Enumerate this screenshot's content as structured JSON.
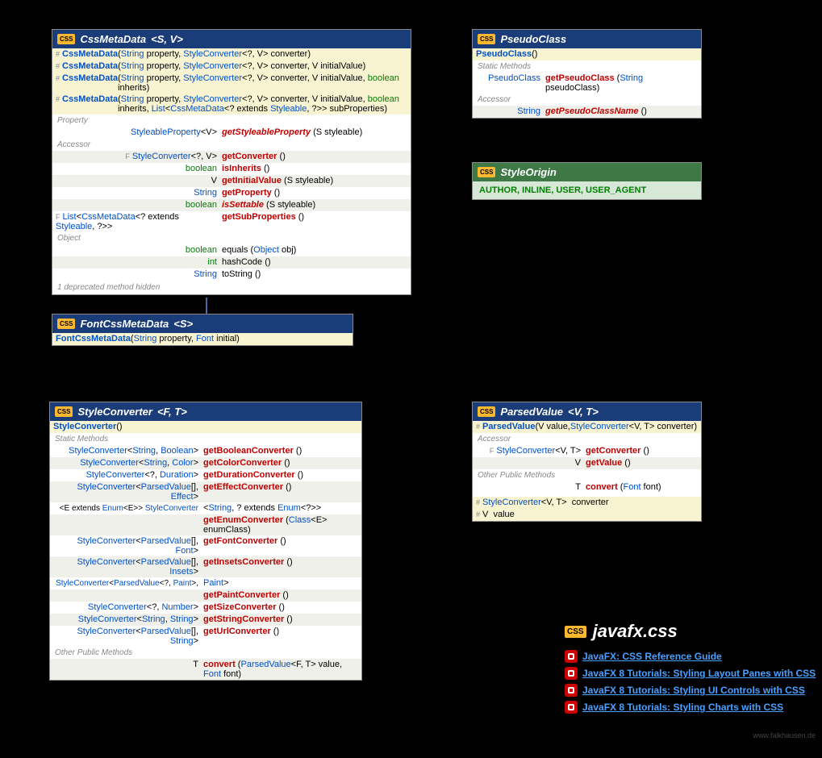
{
  "cards": {
    "cssMeta": {
      "title": "CssMetaData",
      "gp": "<S, V>",
      "ctrs": [
        {
          "name": "CssMetaData",
          "sig": "(String property, StyleConverter<?, V> converter)"
        },
        {
          "name": "CssMetaData",
          "sig": "(String property, StyleConverter<?, V> converter, V initialValue)"
        },
        {
          "name": "CssMetaData",
          "sig": "(String property, StyleConverter<?, V> converter, V initialValue, boolean inherits)"
        },
        {
          "name": "CssMetaData",
          "sig": "(String property, StyleConverter<?, V> converter, V initialValue, boolean inherits, List<CssMetaData<? extends Styleable, ?>> subProperties)"
        }
      ],
      "secProp": "Property",
      "prop": {
        "ret": "StyleableProperty<V>",
        "name": "getStyleableProperty",
        "sig": "(S styleable)"
      },
      "secAcc": "Accessor",
      "acc": [
        {
          "mod": "F",
          "ret": "StyleConverter<?, V>",
          "name": "getConverter",
          "sig": "()"
        },
        {
          "mod": "",
          "ret": "boolean",
          "name": "isInherits",
          "sig": "()",
          "kw": true
        },
        {
          "mod": "",
          "ret": "V",
          "name": "getInitialValue",
          "sig": "(S styleable)"
        },
        {
          "mod": "",
          "ret": "String",
          "name": "getProperty",
          "sig": "()"
        },
        {
          "mod": "",
          "ret": "boolean",
          "name": "isSettable",
          "sig": "(S styleable)",
          "kw": true
        },
        {
          "mod": "F",
          "ret": "List<CssMetaData<? extends Styleable, ?>>",
          "name": "getSubProperties",
          "sig": "()"
        }
      ],
      "secObj": "Object",
      "obj": [
        {
          "ret": "boolean",
          "name": "equals",
          "sig": "(Object obj)",
          "kw": true,
          "plain": true
        },
        {
          "ret": "int",
          "name": "hashCode",
          "sig": "()",
          "kw": true,
          "plain": true
        },
        {
          "ret": "String",
          "name": "toString",
          "sig": "()",
          "plain": true
        }
      ],
      "note": "1 deprecated method hidden"
    },
    "font": {
      "title": "FontCssMetaData",
      "gp": "<S>",
      "ctr": {
        "name": "FontCssMetaData",
        "sig": "(String property, Font initial)"
      }
    },
    "pseudo": {
      "title": "PseudoClass",
      "ctr": {
        "name": "PseudoClass",
        "sig": "()"
      },
      "secStatic": "Static Methods",
      "static": {
        "ret": "PseudoClass",
        "name": "getPseudoClass",
        "sig": "(String pseudoClass)"
      },
      "secAcc": "Accessor",
      "acc": {
        "ret": "String",
        "name": "getPseudoClassName",
        "sig": "()"
      }
    },
    "origin": {
      "title": "StyleOrigin",
      "values": "AUTHOR, INLINE, USER, USER_AGENT"
    },
    "conv": {
      "title": "StyleConverter",
      "gp": "<F, T>",
      "ctr": {
        "name": "StyleConverter",
        "sig": "()"
      },
      "secStatic": "Static Methods",
      "statics": [
        {
          "ret": "StyleConverter<String, Boolean>",
          "name": "getBooleanConverter",
          "sig": "()"
        },
        {
          "ret": "StyleConverter<String, Color>",
          "name": "getColorConverter",
          "sig": "()"
        },
        {
          "ret": "StyleConverter<?, Duration>",
          "name": "getDurationConverter",
          "sig": "()"
        },
        {
          "ret": "StyleConverter<ParsedValue[], Effect>",
          "name": "getEffectConverter",
          "sig": "()"
        },
        {
          "ret": "<E extends Enum<E>> StyleConverter<String, ? extends Enum<?>>",
          "name": "",
          "sig": ""
        },
        {
          "ret": "",
          "name": "getEnumConverter",
          "sig": "(Class<E> enumClass)"
        },
        {
          "ret": "StyleConverter<ParsedValue[], Font>",
          "name": "getFontConverter",
          "sig": "()"
        },
        {
          "ret": "StyleConverter<ParsedValue[], Insets>",
          "name": "getInsetsConverter",
          "sig": "()"
        },
        {
          "ret": "StyleConverter<ParsedValue<?, Paint>, Paint>",
          "name": "",
          "sig": ""
        },
        {
          "ret": "",
          "name": "getPaintConverter",
          "sig": "()"
        },
        {
          "ret": "StyleConverter<?, Number>",
          "name": "getSizeConverter",
          "sig": "()"
        },
        {
          "ret": "StyleConverter<String, String>",
          "name": "getStringConverter",
          "sig": "()"
        },
        {
          "ret": "StyleConverter<ParsedValue[], String>",
          "name": "getUrlConverter",
          "sig": "()"
        }
      ],
      "secOther": "Other Public Methods",
      "other": {
        "ret": "T",
        "name": "convert",
        "sig": "(ParsedValue<F, T> value, Font font)"
      }
    },
    "parsed": {
      "title": "ParsedValue",
      "gp": "<V, T>",
      "ctr": {
        "pfx": "#",
        "name": "ParsedValue",
        "sig": "(V value, StyleConverter<V, T> converter)"
      },
      "secAcc": "Accessor",
      "acc": [
        {
          "mod": "F",
          "ret": "StyleConverter<V, T>",
          "name": "getConverter",
          "sig": "()"
        },
        {
          "mod": "",
          "ret": "V",
          "name": "getValue",
          "sig": "()"
        }
      ],
      "secOther": "Other Public Methods",
      "other": {
        "ret": "T",
        "name": "convert",
        "sig": "(Font font)"
      },
      "fields": [
        {
          "pfx": "#",
          "ret": "StyleConverter<V, T>",
          "name": "converter"
        },
        {
          "pfx": "#",
          "ret": "V",
          "name": "value"
        }
      ]
    }
  },
  "pkg": {
    "title": "javafx.css",
    "links": [
      "JavaFX: CSS Reference Guide",
      "JavaFX 8 Tutorials: Styling Layout Panes with CSS",
      "JavaFX 8 Tutorials: Styling UI Controls with CSS",
      "JavaFX 8 Tutorials: Styling Charts with CSS"
    ]
  },
  "watermark": "www.falkhausen.de"
}
